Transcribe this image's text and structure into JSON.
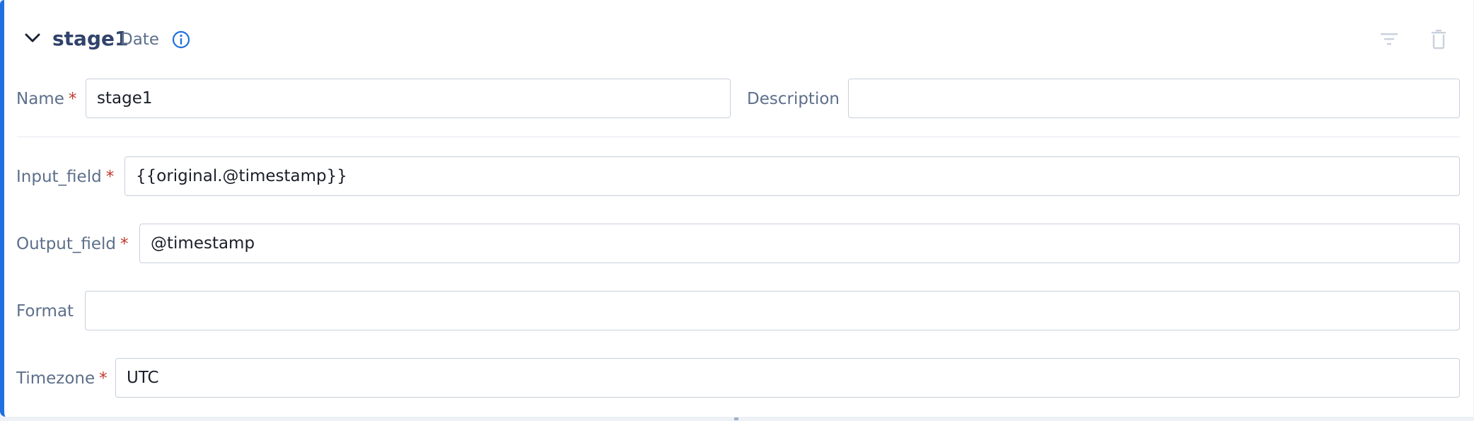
{
  "stage": {
    "title": "stage1",
    "type_label": "Date"
  },
  "icons": {
    "collapse": "chevron-down",
    "info": "info-circle",
    "filter": "filter-lines",
    "delete": "trash-can"
  },
  "colors": {
    "accent": "#1f6fe0",
    "title": "#31436b",
    "label": "#5d6f8b",
    "required": "#c0392b",
    "border": "#c8d0dc"
  },
  "fields": {
    "name": {
      "label": "Name",
      "required_mark": "*",
      "value": "stage1"
    },
    "description": {
      "label": "Description",
      "value": ""
    },
    "input_field": {
      "label": "Input_field",
      "required_mark": "*",
      "value": "{{original.@timestamp}}"
    },
    "output_field": {
      "label": "Output_field",
      "required_mark": "*",
      "value": "@timestamp"
    },
    "format": {
      "label": "Format",
      "value": ""
    },
    "timezone": {
      "label": "Timezone",
      "required_mark": "*",
      "value": "UTC"
    }
  }
}
